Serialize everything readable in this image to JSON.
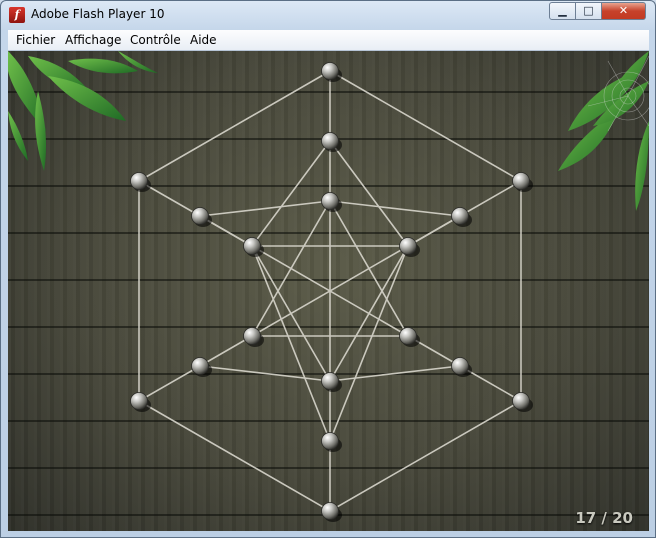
{
  "window": {
    "title": "Adobe Flash Player 10",
    "icon": "flash-icon",
    "controls": {
      "minimize": "▁",
      "maximize": "□",
      "close": "✕"
    }
  },
  "menu": [
    {
      "label": "Fichier"
    },
    {
      "label": "Affichage"
    },
    {
      "label": "Contrôle"
    },
    {
      "label": "Aide"
    }
  ],
  "game": {
    "counter": "17 / 20",
    "colors": {
      "rope": "#d8d6cc",
      "bead": "#c8c8c4"
    }
  }
}
